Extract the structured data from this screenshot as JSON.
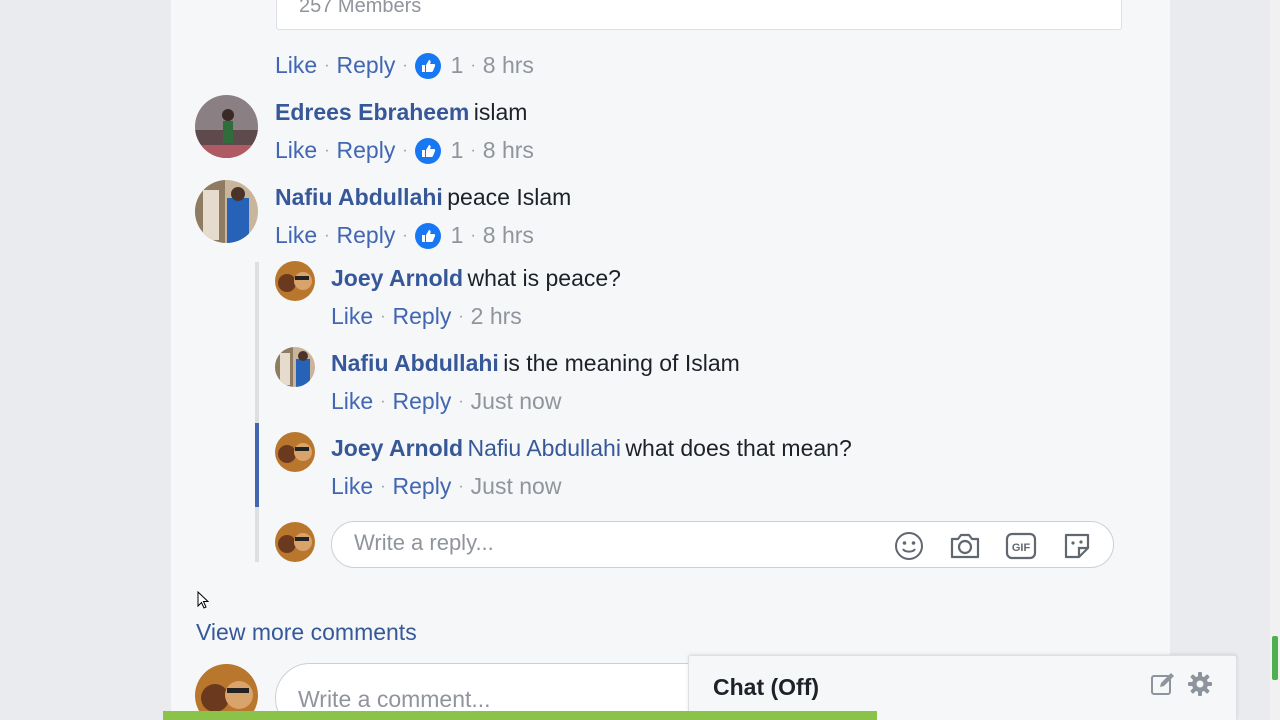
{
  "top_card": {
    "members_text": "257 Members"
  },
  "comments": [
    {
      "name": "",
      "text": "",
      "like": "Like",
      "reply": "Reply",
      "likes": "1",
      "time": "8 hrs"
    },
    {
      "name": "Edrees Ebraheem",
      "text": "islam",
      "like": "Like",
      "reply": "Reply",
      "likes": "1",
      "time": "8 hrs"
    },
    {
      "name": "Nafiu Abdullahi",
      "text": "peace Islam",
      "like": "Like",
      "reply": "Reply",
      "likes": "1",
      "time": "8 hrs"
    }
  ],
  "replies": [
    {
      "name": "Joey Arnold",
      "mention": "",
      "text": "what is peace?",
      "like": "Like",
      "reply": "Reply",
      "time": "2 hrs"
    },
    {
      "name": "Nafiu Abdullahi",
      "mention": "",
      "text": "is the meaning of Islam",
      "like": "Like",
      "reply": "Reply",
      "time": "Just now"
    },
    {
      "name": "Joey Arnold",
      "mention": "Nafiu Abdullahi",
      "text": "what does that mean?",
      "like": "Like",
      "reply": "Reply",
      "time": "Just now"
    }
  ],
  "reply_box": {
    "placeholder": "Write a reply...",
    "icons": [
      "smiley-icon",
      "camera-icon",
      "gif-icon",
      "sticker-icon"
    ]
  },
  "view_more": "View more comments",
  "comment_box": {
    "placeholder": "Write a comment..."
  },
  "chat": {
    "title": "Chat (Off)",
    "icons": [
      "compose-icon",
      "gear-icon"
    ]
  },
  "colors": {
    "link": "#365899",
    "action": "#4267b2",
    "like_badge": "#1877f2",
    "meta": "#90949c",
    "progress": "#8bc34a"
  }
}
